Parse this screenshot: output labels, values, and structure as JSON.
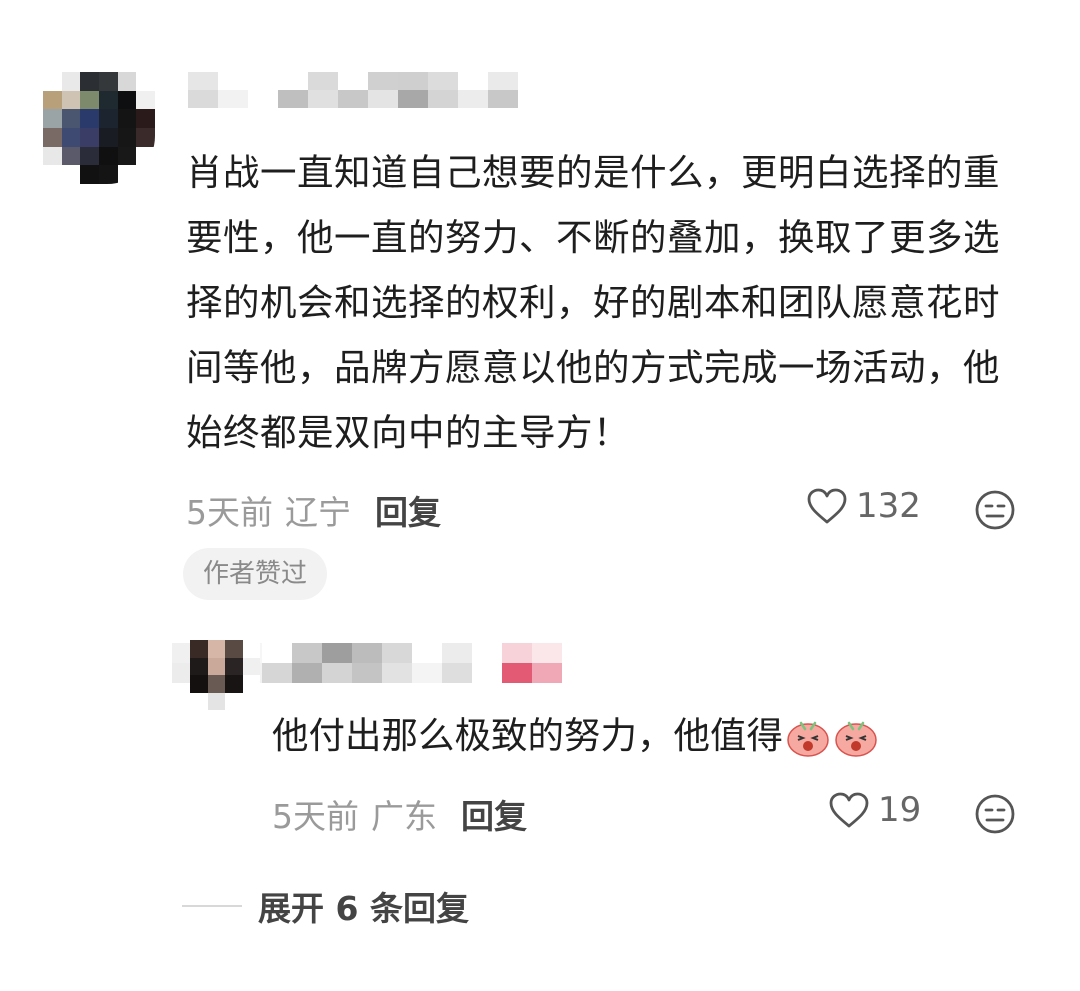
{
  "comment": {
    "text": "肖战一直知道自己想要的是什么，更明白选择的重要性，他一直的努力、不断的叠加，换取了更多选择的机会和选择的权利，好的剧本和团队愿意花时间等他，品牌方愿意以他的方式完成一场活动，他始终都是双向中的主导方！",
    "time": "5天前",
    "location": "辽宁",
    "reply_label": "回复",
    "likes": "132",
    "badge": "作者赞过",
    "icons": {
      "like": "heart-outline-icon",
      "react": "neutral-face-icon"
    }
  },
  "reply": {
    "text": "他付出那么极致的努力，他值得",
    "emojis": [
      "excited-blob-emoji",
      "excited-blob-emoji"
    ],
    "time": "5天前",
    "location": "广东",
    "reply_label": "回复",
    "likes": "19"
  },
  "expand_label": "展开 6 条回复",
  "colors": {
    "text": "#1e1e1e",
    "meta": "#9a9a9a",
    "badge_bg": "#f2f2f2"
  }
}
